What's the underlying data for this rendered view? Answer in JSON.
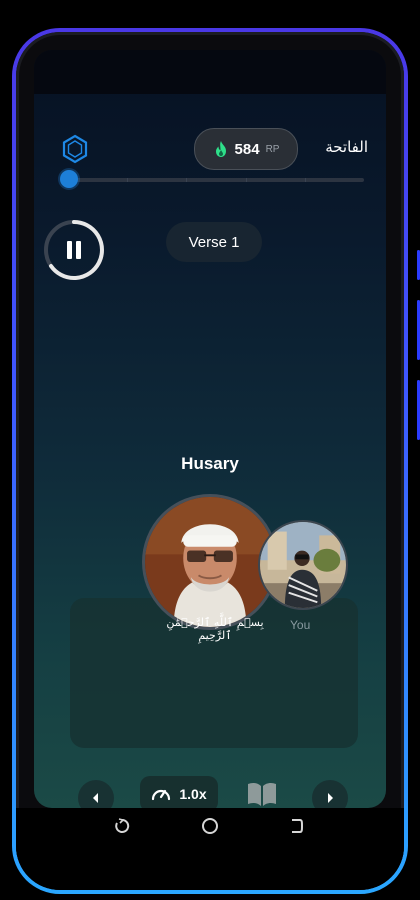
{
  "header": {
    "rp_value": "584",
    "rp_unit": "RP",
    "surah_name": "الفاتحة"
  },
  "progress": {
    "value": 0.0
  },
  "player": {
    "state": "playing",
    "verse_label": "Verse 1",
    "reciter_name": "Husary",
    "arabic_text": "بِسۡمِ ٱللَّهِ ٱلرَّحۡمَٰنِ ٱلرَّحِيمِ",
    "you_label": "You"
  },
  "controls": {
    "speed_label": "1.0x"
  },
  "icons": {
    "logo": "hexagon-logo-icon",
    "fire": "fire-icon",
    "pause": "pause-icon",
    "prev": "chevron-left-icon",
    "next": "chevron-right-icon",
    "speed": "speedometer-icon",
    "book": "open-book-icon",
    "recents": "recents-icon",
    "home": "home-icon",
    "back": "back-icon"
  },
  "colors": {
    "accent": "#1d7fd8",
    "fire": "#2ee08a",
    "frame": "#3f56ff"
  }
}
